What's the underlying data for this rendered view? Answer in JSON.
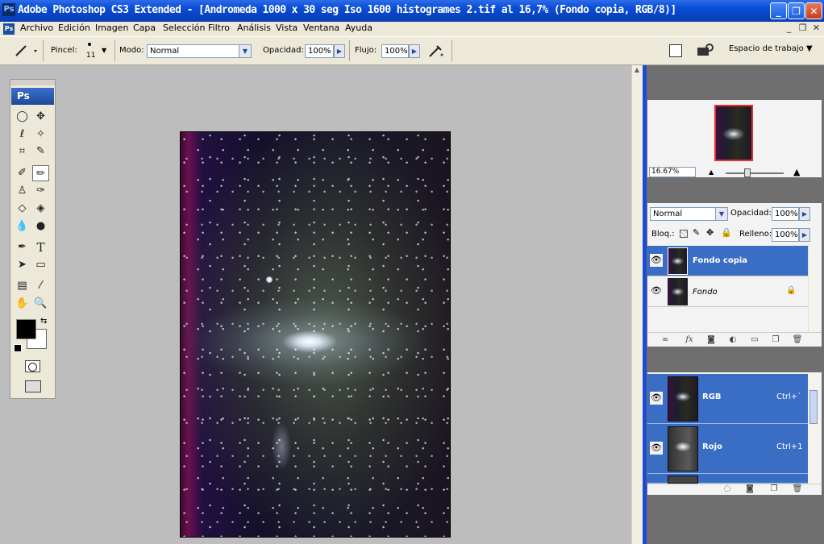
{
  "window": {
    "title": "Adobe Photoshop CS3 Extended - [Andromeda 1000 x 30 seg Iso 1600 histogrames 2.tif al 16,7% (Fondo copia, RGB/8)]",
    "app_icon": "Ps",
    "controls": {
      "minimize": "_",
      "maximize": "❐",
      "close": "✕"
    }
  },
  "menu": {
    "doc_icon": "Ps",
    "items": [
      "Archivo",
      "Edición",
      "Imagen",
      "Capa",
      "Selección",
      "Filtro",
      "Análisis",
      "Vista",
      "Ventana",
      "Ayuda"
    ],
    "doc_controls": [
      "_",
      "❐",
      "✕"
    ]
  },
  "options": {
    "brush_label": "Pincel:",
    "brush_size": "11",
    "mode_label": "Modo:",
    "mode_value": "Normal",
    "opacity_label": "Opacidad:",
    "opacity_value": "100%",
    "flow_label": "Flujo:",
    "flow_value": "100%",
    "workspace_label": "Espacio de trabajo"
  },
  "tools": {
    "logo": "Ps",
    "type_tool": "T"
  },
  "navigator": {
    "zoom": "16.67%"
  },
  "layers": {
    "blend_mode": "Normal",
    "opacity_label": "Opacidad:",
    "opacity_value": "100%",
    "lock_label": "Bloq.:",
    "fill_label": "Relleno:",
    "fill_value": "100%",
    "rows": [
      {
        "name": "Fondo copia",
        "selected": true
      },
      {
        "name": "Fondo",
        "selected": false,
        "locked": true
      }
    ],
    "footer_icons": [
      "link-icon",
      "fx-icon",
      "mask-icon",
      "adjustment-icon",
      "group-icon",
      "new-layer-icon",
      "trash-icon"
    ],
    "fx_text": "fx"
  },
  "channels": {
    "rows": [
      {
        "name": "RGB",
        "shortcut": "Ctrl+`"
      },
      {
        "name": "Rojo",
        "shortcut": "Ctrl+1"
      }
    ]
  },
  "colors": {
    "titlebar": "#0a4fd8",
    "selected_row": "#3a6ec4",
    "dock_edge": "#1c4cd6"
  }
}
